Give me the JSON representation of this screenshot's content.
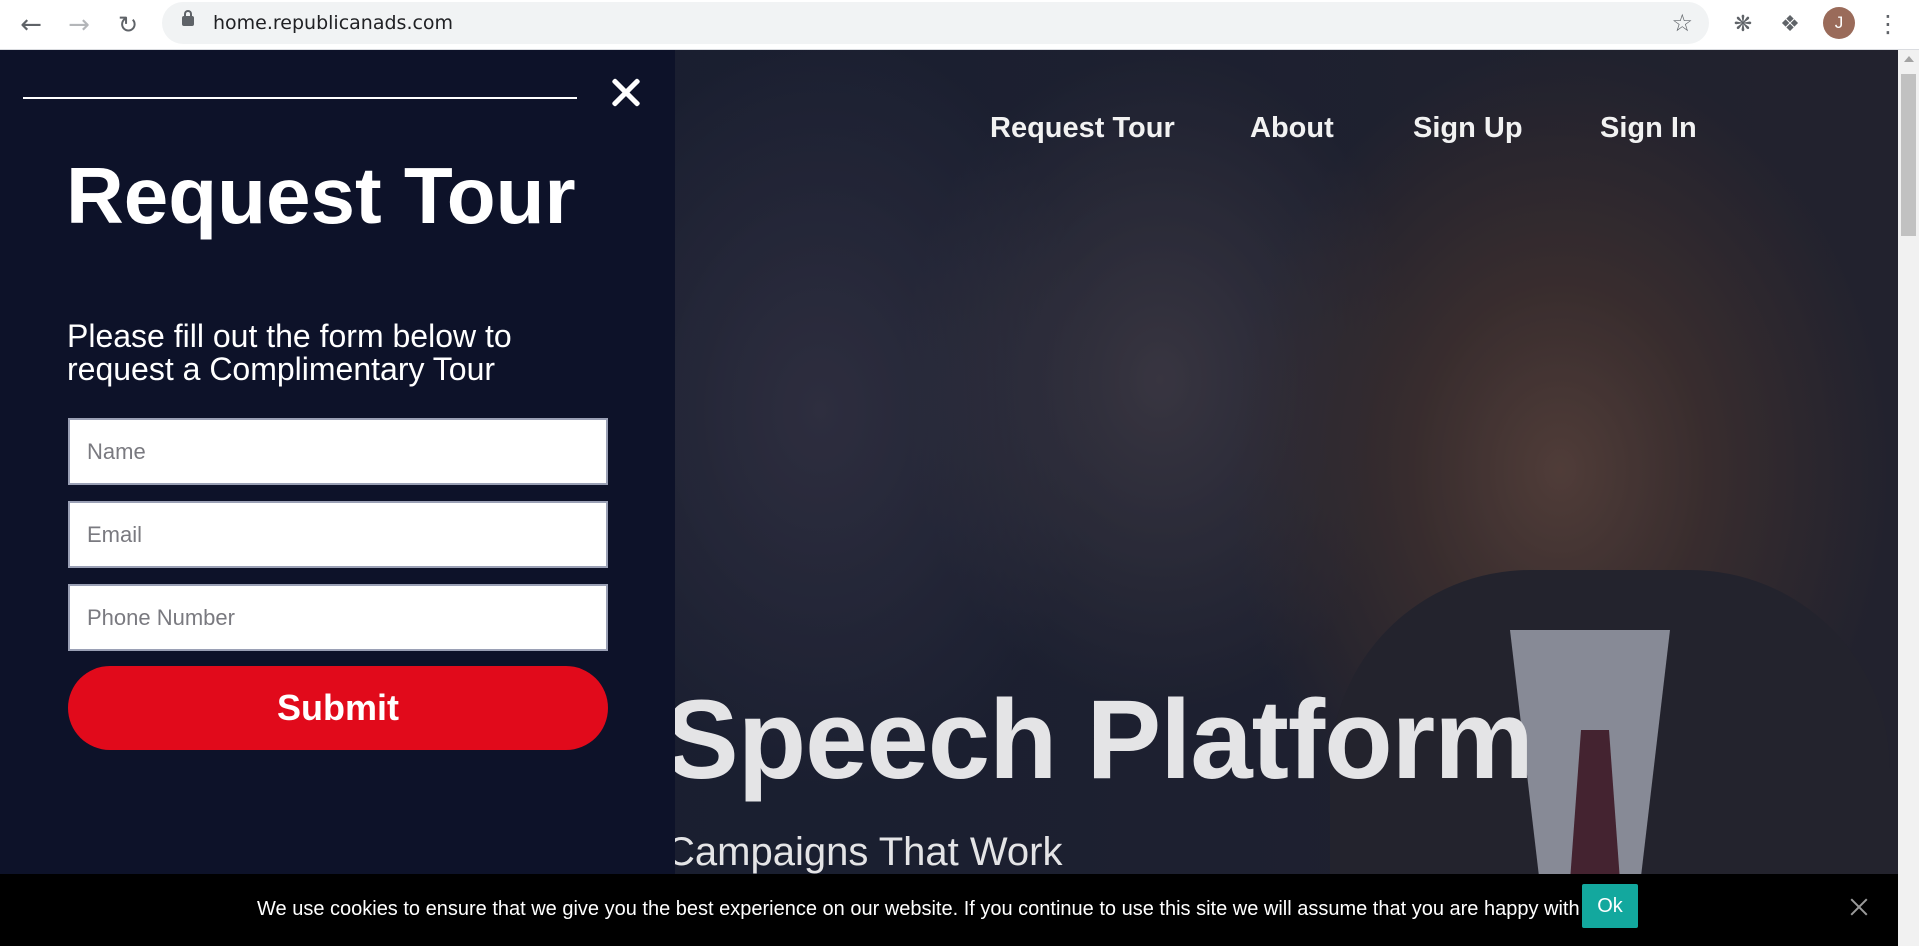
{
  "browser": {
    "url": "home.republicanads.com",
    "profile_initial": "J",
    "icons": {
      "back": "arrow-left-icon",
      "forward": "arrow-right-icon",
      "reload": "reload-icon",
      "lock": "lock-icon",
      "bookmark": "star-icon",
      "extension_1": "bug-icon",
      "extensions": "puzzle-icon",
      "menu": "three-dots-icon"
    }
  },
  "site_nav": {
    "items": [
      "Request Tour",
      "About",
      "Sign Up",
      "Sign In"
    ]
  },
  "hero": {
    "title": "Speech Platform",
    "subtitle": "Campaigns That Work"
  },
  "panel": {
    "title": "Request Tour",
    "description": "Please fill out the form below to request a Complimentary Tour",
    "fields": {
      "name_placeholder": "Name",
      "email_placeholder": "Email",
      "phone_placeholder": "Phone Number"
    },
    "submit_label": "Submit"
  },
  "cookie_bar": {
    "message": "We use cookies to ensure that we give you the best experience on our website. If you continue to use this site we will assume that you are happy with it.",
    "ok_label": "Ok"
  },
  "colors": {
    "panel_bg": "#0d1229",
    "submit_red": "#e10a1b",
    "cookie_ok_teal": "#13a89e"
  }
}
